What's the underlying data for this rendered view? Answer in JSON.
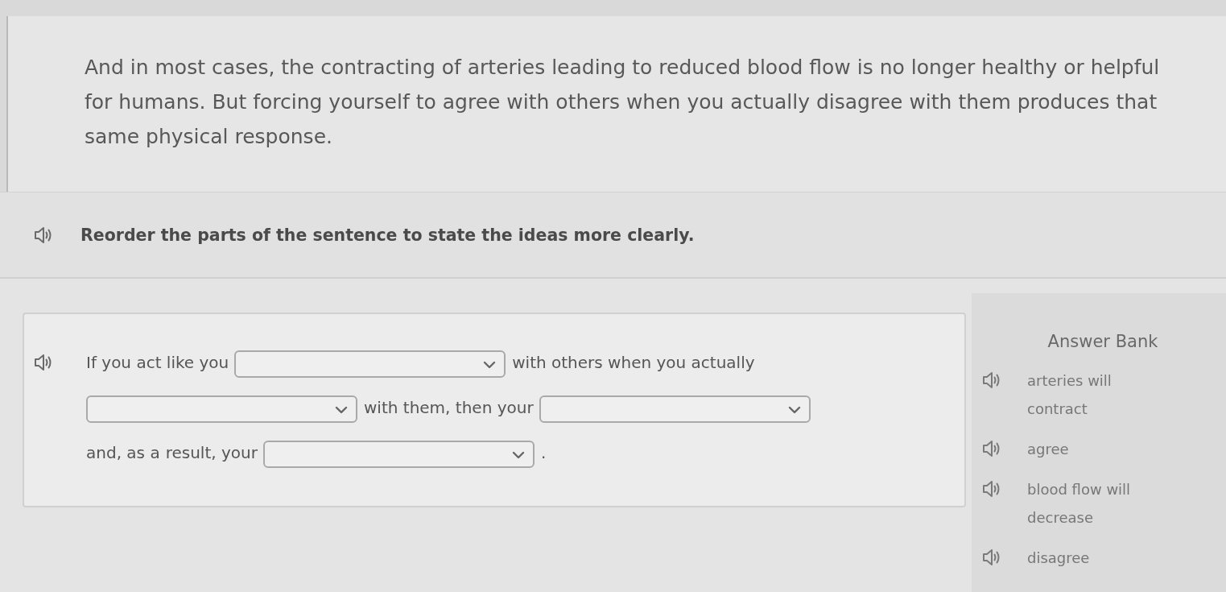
{
  "passage": {
    "text": "And in most cases, the contracting of arteries leading to reduced blood flow is no longer healthy or helpful for humans. But forcing yourself to agree with others when you actually disagree with them produces that same physical response."
  },
  "instruction": {
    "text": "Reorder the parts of the sentence to state the ideas more clearly."
  },
  "question": {
    "parts": [
      {
        "kind": "text",
        "text": "If you act like you"
      },
      {
        "kind": "dropdown"
      },
      {
        "kind": "text",
        "text": "with others when you actually"
      },
      {
        "kind": "dropdown"
      },
      {
        "kind": "text",
        "text": "with them, then your"
      },
      {
        "kind": "dropdown"
      },
      {
        "kind": "text",
        "text": "and, as a"
      },
      {
        "kind": "text",
        "text": "result, your"
      },
      {
        "kind": "dropdown"
      },
      {
        "kind": "text",
        "text": "."
      }
    ]
  },
  "answer_bank": {
    "title": "Answer Bank",
    "items": [
      "arteries will contract",
      "agree",
      "blood flow will decrease",
      "disagree"
    ]
  }
}
